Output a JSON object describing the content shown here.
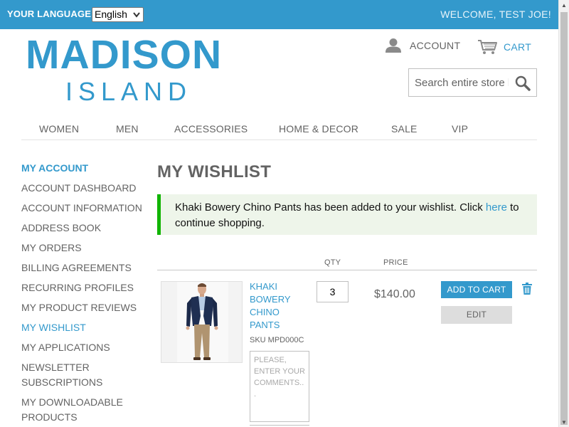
{
  "topbar": {
    "language_label": "YOUR LANGUAGE:",
    "language_selected": "English",
    "welcome": "WELCOME, TEST JOE!"
  },
  "logo": {
    "line1": "MADISON",
    "line2": "ISLAND"
  },
  "header": {
    "account_label": "ACCOUNT",
    "cart_label": "CART",
    "search_placeholder": "Search entire store here..."
  },
  "nav": {
    "items": [
      "WOMEN",
      "MEN",
      "ACCESSORIES",
      "HOME & DECOR",
      "SALE",
      "VIP"
    ]
  },
  "sidebar": {
    "title": "MY ACCOUNT",
    "links": [
      "ACCOUNT DASHBOARD",
      "ACCOUNT INFORMATION",
      "ADDRESS BOOK",
      "MY ORDERS",
      "BILLING AGREEMENTS",
      "RECURRING PROFILES",
      "MY PRODUCT REVIEWS",
      "MY WISHLIST",
      "MY APPLICATIONS",
      "NEWSLETTER SUBSCRIPTIONS",
      "MY DOWNLOADABLE PRODUCTS"
    ],
    "active_link": "MY WISHLIST"
  },
  "main": {
    "title": "MY WISHLIST",
    "message_before": "Khaki Bowery Chino Pants has been added to your wishlist. Click ",
    "message_link": "here",
    "message_after": " to continue shopping.",
    "columns": {
      "qty": "QTY",
      "price": "PRICE"
    },
    "item": {
      "name": "KHAKI BOWERY CHINO PANTS",
      "sku": "SKU MPD000C",
      "comment_placeholder": "PLEASE, ENTER YOUR COMMENTS...",
      "qty": "3",
      "price": "$140.00",
      "add_to_cart": "ADD TO CART",
      "edit": "EDIT"
    }
  },
  "colors": {
    "brand": "#3399cc",
    "text": "#636363",
    "success_border": "#11b400",
    "success_bg": "#eef5ea"
  },
  "icons": {
    "account": "person-icon",
    "cart": "cart-icon",
    "search": "magnifier-icon",
    "remove": "trash-icon"
  }
}
